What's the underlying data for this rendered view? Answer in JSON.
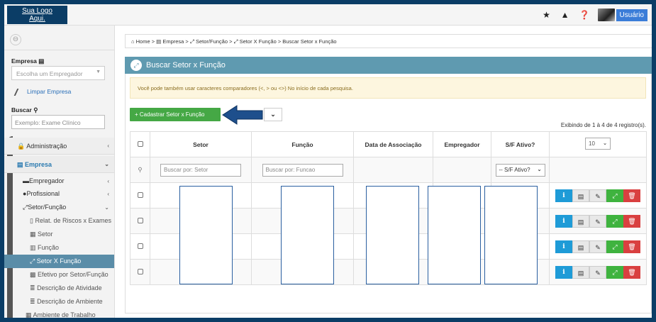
{
  "logo": {
    "line1": "Sua Logo",
    "line2": "Aqui."
  },
  "topbar": {
    "user_label": "Usuário"
  },
  "sidebar": {
    "toggle_icon": "⊖",
    "empresa_label": "Empresa",
    "empresa_placeholder": "Escolha um Empregador",
    "limpar_label": "Limpar Empresa",
    "buscar_label": "Buscar",
    "buscar_placeholder": "Exemplo: Exame Clínico",
    "menu": [
      {
        "label": "Administração",
        "icon": "🔒"
      },
      {
        "label": "Empresa",
        "icon": "▤"
      },
      {
        "label": "Empregador",
        "icon": "▬"
      },
      {
        "label": "Profissional",
        "icon": "●"
      },
      {
        "label": "Setor/Função",
        "icon": "⤢"
      },
      {
        "label": "Relat. de Riscos x Exames",
        "icon": "▯"
      },
      {
        "label": "Setor",
        "icon": "▦"
      },
      {
        "label": "Função",
        "icon": "▥"
      },
      {
        "label": "Setor X Função",
        "icon": "⤢"
      },
      {
        "label": "Efetivo por Setor/Função",
        "icon": "▩"
      },
      {
        "label": "Descrição de Atividade",
        "icon": "≣"
      },
      {
        "label": "Descrição de Ambiente",
        "icon": "≣"
      },
      {
        "label": "Ambiente de Trabalho",
        "icon": "▦"
      }
    ]
  },
  "breadcrumb": "⌂ Home > ▤ Empresa > ⤢ Setor/Função > ⤢ Setor X Função > Buscar Setor x Função",
  "panel": {
    "title": "Buscar Setor x Função"
  },
  "alert": "Você pode também usar caracteres comparadores (<, > ou <>) No início de cada pesquisa.",
  "actions": {
    "cadastrar": "+ Cadastrar Setor x Função",
    "dropdown": "⌄"
  },
  "table": {
    "showing": "Exibindo de 1 à 4 de 4 registro(s).",
    "page_size": "10",
    "headers": [
      "Setor",
      "Função",
      "Data de Associação",
      "Empregador",
      "S/F Ativo?"
    ],
    "filter_setor": "Buscar por: Setor",
    "filter_funcao": "Buscar por: Funcao",
    "filter_ativo": "-- S/F Ativo?",
    "row_count": 4
  },
  "colors": {
    "header": "#5f9ab0",
    "frame": "#0b3d66",
    "green": "#45a845",
    "red": "#d94040",
    "info": "#1e9bd7"
  },
  "icons": [
    "star-icon",
    "warning-icon",
    "help-icon",
    "info-icon",
    "list-icon",
    "edit-icon",
    "expand-icon",
    "trash-icon"
  ]
}
